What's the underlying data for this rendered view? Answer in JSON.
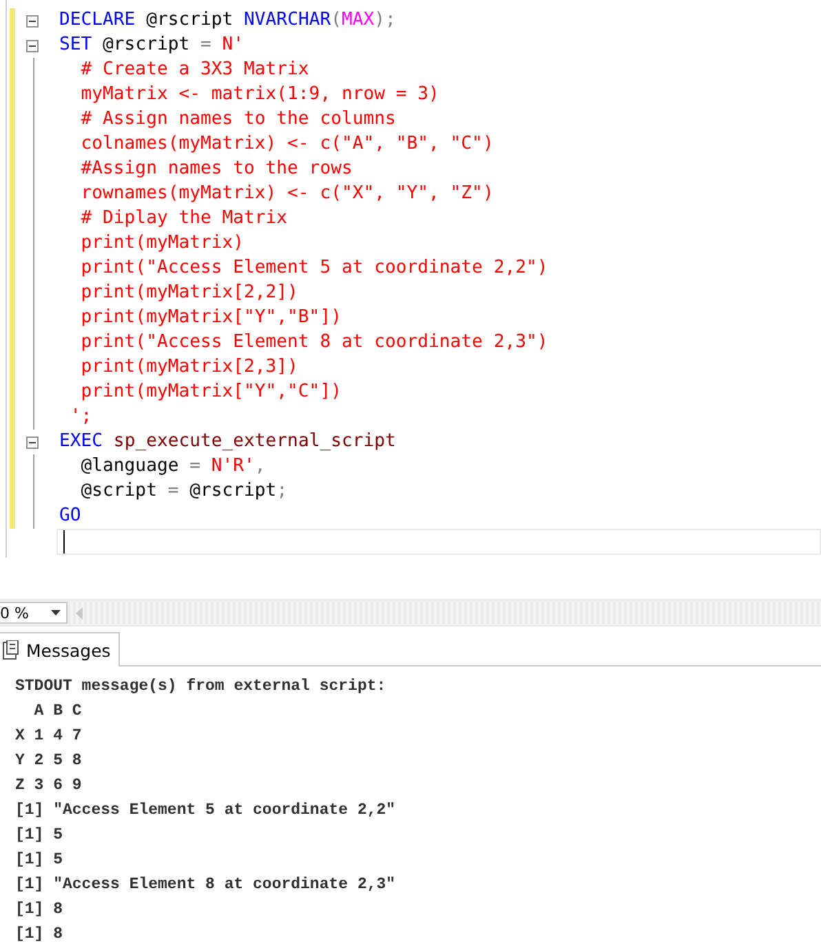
{
  "editor": {
    "lines": [
      {
        "collapsible": true,
        "tokens": [
          {
            "kind": "keyword",
            "text": "DECLARE"
          },
          {
            "kind": "plain",
            "text": " @rscript "
          },
          {
            "kind": "keyword",
            "text": "NVARCHAR"
          },
          {
            "kind": "operator",
            "text": "("
          },
          {
            "kind": "function",
            "text": "MAX"
          },
          {
            "kind": "operator",
            "text": ");"
          }
        ]
      },
      {
        "collapsible": true,
        "tokens": [
          {
            "kind": "keyword",
            "text": "SET"
          },
          {
            "kind": "plain",
            "text": " @rscript "
          },
          {
            "kind": "operator",
            "text": "="
          },
          {
            "kind": "string",
            "text": " N'"
          }
        ]
      },
      {
        "collapsible": false,
        "tokens": [
          {
            "kind": "string",
            "text": "  # Create a 3X3 Matrix"
          }
        ]
      },
      {
        "collapsible": false,
        "tokens": [
          {
            "kind": "string",
            "text": "  myMatrix <- matrix(1:9, nrow = 3)"
          }
        ]
      },
      {
        "collapsible": false,
        "tokens": [
          {
            "kind": "string",
            "text": "  # Assign names to the columns"
          }
        ]
      },
      {
        "collapsible": false,
        "tokens": [
          {
            "kind": "string",
            "text": "  colnames(myMatrix) <- c(\"A\", \"B\", \"C\")"
          }
        ]
      },
      {
        "collapsible": false,
        "tokens": [
          {
            "kind": "string",
            "text": "  #Assign names to the rows"
          }
        ]
      },
      {
        "collapsible": false,
        "tokens": [
          {
            "kind": "string",
            "text": "  rownames(myMatrix) <- c(\"X\", \"Y\", \"Z\")"
          }
        ]
      },
      {
        "collapsible": false,
        "tokens": [
          {
            "kind": "string",
            "text": "  # Diplay the Matrix"
          }
        ]
      },
      {
        "collapsible": false,
        "tokens": [
          {
            "kind": "string",
            "text": "  print(myMatrix)"
          }
        ]
      },
      {
        "collapsible": false,
        "tokens": [
          {
            "kind": "string",
            "text": "  print(\"Access Element 5 at coordinate 2,2\")"
          }
        ]
      },
      {
        "collapsible": false,
        "tokens": [
          {
            "kind": "string",
            "text": "  print(myMatrix[2,2])"
          }
        ]
      },
      {
        "collapsible": false,
        "tokens": [
          {
            "kind": "string",
            "text": "  print(myMatrix[\"Y\",\"B\"])"
          }
        ]
      },
      {
        "collapsible": false,
        "tokens": [
          {
            "kind": "string",
            "text": "  print(\"Access Element 8 at coordinate 2,3\")"
          }
        ]
      },
      {
        "collapsible": false,
        "tokens": [
          {
            "kind": "string",
            "text": "  print(myMatrix[2,3])"
          }
        ]
      },
      {
        "collapsible": false,
        "tokens": [
          {
            "kind": "string",
            "text": "  print(myMatrix[\"Y\",\"C\"])"
          }
        ]
      },
      {
        "collapsible": false,
        "tokens": [
          {
            "kind": "string",
            "text": " ';"
          }
        ]
      },
      {
        "collapsible": true,
        "tokens": [
          {
            "kind": "keyword",
            "text": "EXEC"
          },
          {
            "kind": "procedure",
            "text": " sp_execute_external_script"
          }
        ]
      },
      {
        "collapsible": false,
        "tokens": [
          {
            "kind": "plain",
            "text": "  @language "
          },
          {
            "kind": "operator",
            "text": "="
          },
          {
            "kind": "string",
            "text": " N'R'"
          },
          {
            "kind": "operator",
            "text": ","
          }
        ]
      },
      {
        "collapsible": false,
        "tokens": [
          {
            "kind": "plain",
            "text": "  @script "
          },
          {
            "kind": "operator",
            "text": "="
          },
          {
            "kind": "plain",
            "text": " @rscript"
          },
          {
            "kind": "operator",
            "text": ";"
          }
        ]
      },
      {
        "collapsible": false,
        "tokens": [
          {
            "kind": "keyword",
            "text": "GO"
          }
        ]
      }
    ]
  },
  "zoom": {
    "value": "0 %"
  },
  "results": {
    "tabs": [
      {
        "label": "Messages",
        "selected": true
      }
    ],
    "messages": [
      "STDOUT message(s) from external script:",
      "  A B C",
      "X 1 4 7",
      "Y 2 5 8",
      "Z 3 6 9",
      "[1] \"Access Element 5 at coordinate 2,2\"",
      "[1] 5",
      "[1] 5",
      "[1] \"Access Element 8 at coordinate 2,3\"",
      "[1] 8",
      "[1] 8"
    ]
  }
}
